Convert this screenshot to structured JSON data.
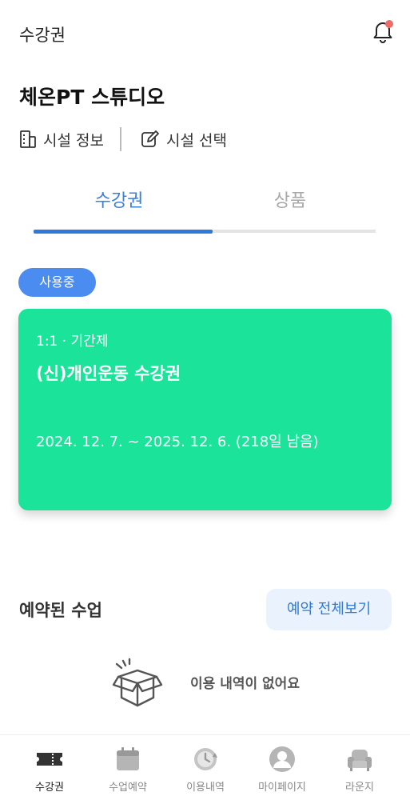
{
  "header": {
    "title": "수강권"
  },
  "studio": {
    "name": "체온PT 스튜디오",
    "facility_info_label": "시설 정보",
    "facility_select_label": "시설 선택"
  },
  "tabs": [
    {
      "label": "수강권",
      "active": true
    },
    {
      "label": "상품",
      "active": false
    }
  ],
  "pass": {
    "status": "사용중",
    "type": "1:1 · 기간제",
    "name": "(신)개인운동 수강권",
    "period": "2024. 12. 7. ~ 2025. 12. 6. (218일 남음)",
    "card_color": "#1be39a"
  },
  "reservations": {
    "title": "예약된 수업",
    "view_all_label": "예약 전체보기",
    "empty_text": "이용 내역이 없어요"
  },
  "bottom_nav": [
    {
      "label": "수강권",
      "icon": "ticket-icon",
      "active": true
    },
    {
      "label": "수업예약",
      "icon": "calendar-icon",
      "active": false
    },
    {
      "label": "이용내역",
      "icon": "history-icon",
      "active": false
    },
    {
      "label": "마이페이지",
      "icon": "profile-icon",
      "active": false
    },
    {
      "label": "라운지",
      "icon": "lounge-chair-icon",
      "active": false
    }
  ],
  "colors": {
    "accent": "#2f7ad9",
    "badge": "#4b8cf0",
    "notification_dot": "#f16a6a"
  }
}
